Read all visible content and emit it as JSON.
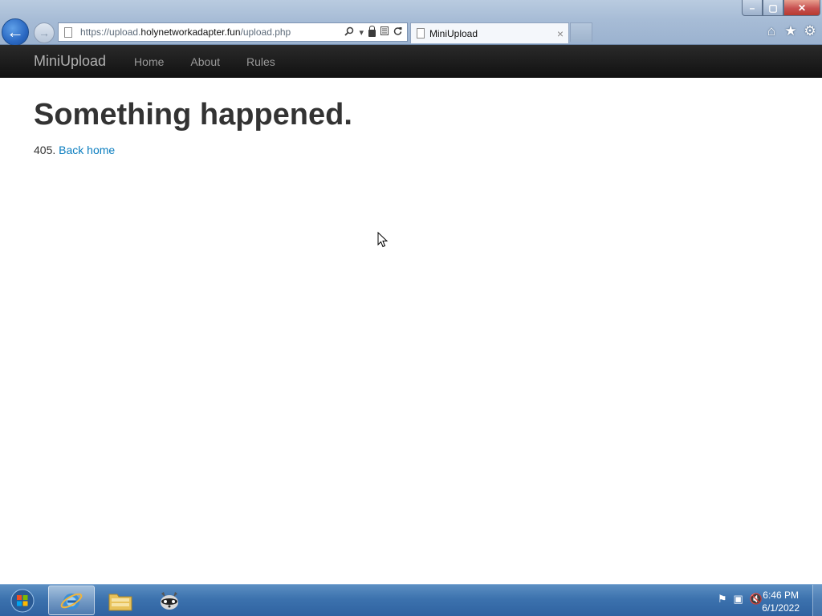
{
  "window": {
    "minimize_glyph": "–",
    "maximize_glyph": "▢",
    "close_glyph": "✕"
  },
  "browser": {
    "url_scheme": "https://",
    "url_subdomain": "upload.",
    "url_domain": "holynetworkadapter.fun",
    "url_path": "/upload.php",
    "tab_title": "MiniUpload",
    "tab_close_glyph": "×"
  },
  "navbar": {
    "brand": "MiniUpload",
    "links": [
      "Home",
      "About",
      "Rules"
    ]
  },
  "content": {
    "heading": "Something happened.",
    "code_text": "405.",
    "back_link": "Back home"
  },
  "taskbar": {
    "time": "6:46 PM",
    "date": "6/1/2022"
  },
  "icons": {
    "back": "back-arrow-icon",
    "forward": "forward-arrow-icon",
    "search": "search-icon",
    "lock": "lock-icon",
    "refresh": "refresh-icon",
    "home": "home-icon",
    "favorites": "star-icon",
    "tools": "gear-icon"
  },
  "colors": {
    "navbar_bg": "#1b1b1b",
    "link": "#0a7dbf",
    "heading": "#333333",
    "taskbar": "#3c72ae"
  }
}
